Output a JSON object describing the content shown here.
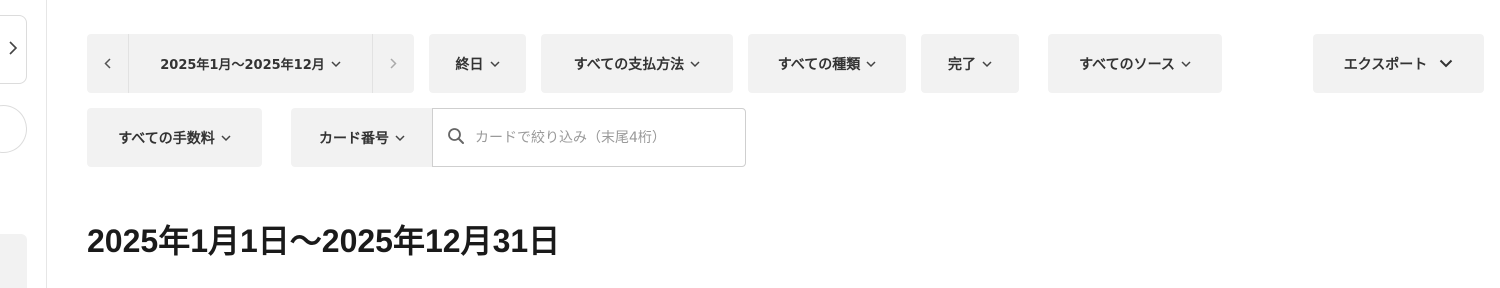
{
  "sidebar": {
    "toggle_icon": "chevron-right-icon"
  },
  "filters": {
    "date_range": {
      "prev_icon": "chevron-left-icon",
      "label": "2025年1月〜2025年12月",
      "next_icon": "chevron-right-icon"
    },
    "time": "終日",
    "payment_method": "すべての支払方法",
    "type": "すべての種類",
    "status": "完了",
    "source": "すべてのソース",
    "export": "エクスポート",
    "fees": "すべての手数料",
    "card_number": "カード番号",
    "card_search": {
      "placeholder": "カードで絞り込み（末尾4桁）",
      "value": ""
    }
  },
  "main": {
    "title": "2025年1月1日〜2025年12月31日"
  },
  "colors": {
    "chip_bg": "#f2f2f2",
    "text": "#333333",
    "heading": "#1a1a1a",
    "placeholder": "#9a9a9a"
  }
}
